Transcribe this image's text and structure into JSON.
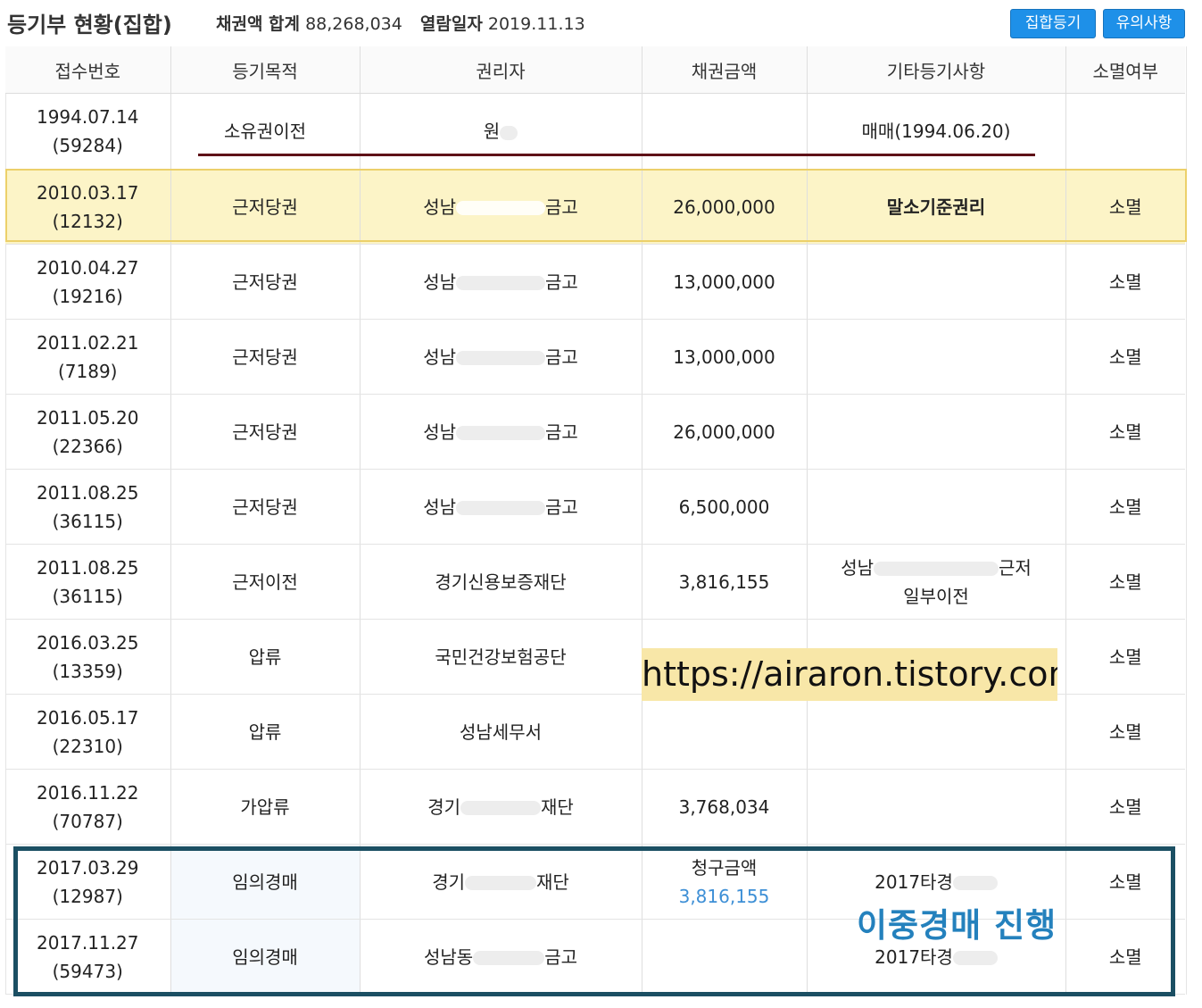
{
  "header": {
    "title": "등기부 현황(집합)",
    "bond_total_label": "채권액 합계",
    "bond_total_value": "88,268,034",
    "view_date_label": "열람일자",
    "view_date_value": "2019.11.13",
    "btn_group_registry": "집합등기",
    "btn_notes": "유의사항"
  },
  "table": {
    "columns": [
      "접수번호",
      "등기목적",
      "권리자",
      "채권금액",
      "기타등기사항",
      "소멸여부"
    ],
    "rows": [
      {
        "date": "1994.07.14",
        "no": "(59284)",
        "purpose": "소유권이전",
        "holder": "원",
        "amount": "",
        "etc": "매매(1994.06.20)",
        "etc2": "",
        "status": ""
      },
      {
        "date": "2010.03.17",
        "no": "(12132)",
        "purpose": "근저당권",
        "holder": "성남",
        "holder_tail": "금고",
        "amount": "26,000,000",
        "etc": "말소기준권리",
        "etc2": "",
        "status": "소멸"
      },
      {
        "date": "2010.04.27",
        "no": "(19216)",
        "purpose": "근저당권",
        "holder": "성남",
        "holder_tail": "금고",
        "amount": "13,000,000",
        "etc": "",
        "etc2": "",
        "status": "소멸"
      },
      {
        "date": "2011.02.21",
        "no": "(7189)",
        "purpose": "근저당권",
        "holder": "성남",
        "holder_tail": "금고",
        "amount": "13,000,000",
        "etc": "",
        "etc2": "",
        "status": "소멸"
      },
      {
        "date": "2011.05.20",
        "no": "(22366)",
        "purpose": "근저당권",
        "holder": "성남",
        "holder_tail": "금고",
        "amount": "26,000,000",
        "etc": "",
        "etc2": "",
        "status": "소멸"
      },
      {
        "date": "2011.08.25",
        "no": "(36115)",
        "purpose": "근저당권",
        "holder": "성남",
        "holder_tail": "금고",
        "amount": "6,500,000",
        "etc": "",
        "etc2": "",
        "status": "소멸"
      },
      {
        "date": "2011.08.25",
        "no": "(36115)",
        "purpose": "근저이전",
        "holder": "경기신용보증재단",
        "holder_tail": "",
        "amount": "3,816,155",
        "etc": "성남",
        "etc_tail": "근저",
        "etc2": "일부이전",
        "status": "소멸"
      },
      {
        "date": "2016.03.25",
        "no": "(13359)",
        "purpose": "압류",
        "holder": "국민건강보험공단",
        "holder_tail": "",
        "amount": "",
        "etc": "",
        "etc2": "",
        "status": "소멸"
      },
      {
        "date": "2016.05.17",
        "no": "(22310)",
        "purpose": "압류",
        "holder": "성남세무서",
        "holder_tail": "",
        "amount": "",
        "etc": "",
        "etc2": "",
        "status": "소멸"
      },
      {
        "date": "2016.11.22",
        "no": "(70787)",
        "purpose": "가압류",
        "holder": "경기",
        "holder_tail": "재단",
        "amount": "3,768,034",
        "etc": "",
        "etc2": "",
        "status": "소멸"
      },
      {
        "date": "2017.03.29",
        "no": "(12987)",
        "purpose": "임의경매",
        "holder": "경기",
        "holder_tail": "재단",
        "amount_label": "청구금액",
        "amount": "3,816,155",
        "etc": "2017타경",
        "etc2": "",
        "status": "소멸"
      },
      {
        "date": "2017.11.27",
        "no": "(59473)",
        "purpose": "임의경매",
        "holder": "성남동",
        "holder_tail": "금고",
        "amount": "",
        "etc": "2017타경",
        "etc2": "",
        "status": "소멸"
      }
    ]
  },
  "overlay": {
    "watermark": "https://airaron.tistory.com",
    "dual_auction_label": "이중경매 진행"
  },
  "colors": {
    "button_blue": "#1e90e8",
    "highlight_fill": "#fcf4c7",
    "highlight_border": "#ecd06a",
    "underline": "#5e1117",
    "box_border": "#1b4f63",
    "label_blue": "#2481bd",
    "claim_blue": "#3d8fd6"
  }
}
